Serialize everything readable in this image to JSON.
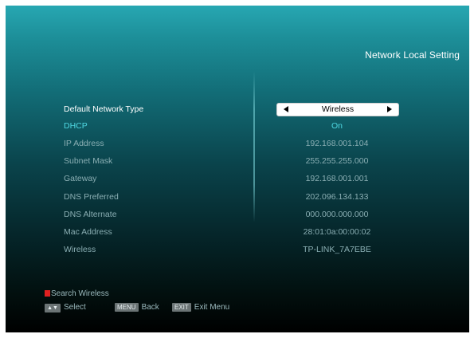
{
  "header": {
    "title": "Network Local Setting"
  },
  "settings": {
    "default_network_type": {
      "label": "Default Network Type",
      "value": "Wireless"
    },
    "rows": [
      {
        "label": "DHCP",
        "value": "On"
      },
      {
        "label": "IP Address",
        "value": "192.168.001.104"
      },
      {
        "label": "Subnet Mask",
        "value": "255.255.255.000"
      },
      {
        "label": "Gateway",
        "value": "192.168.001.001"
      },
      {
        "label": "DNS Preferred",
        "value": "202.096.134.133"
      },
      {
        "label": "DNS Alternate",
        "value": "000.000.000.000"
      },
      {
        "label": "Mac Address",
        "value": "28:01:0a:00:00:02"
      },
      {
        "label": "Wireless",
        "value": "TP-LINK_7A7EBE"
      }
    ]
  },
  "footer": {
    "search_wireless": "Search Wireless",
    "select_key": "▲▼",
    "select_label": "Select",
    "menu_key": "MENU",
    "menu_label": "Back",
    "exit_key": "EXIT",
    "exit_label": "Exit Menu"
  },
  "colors": {
    "highlight": "#4fd9e3",
    "text_dim": "#8aaeb3",
    "red_key": "#e02020"
  }
}
